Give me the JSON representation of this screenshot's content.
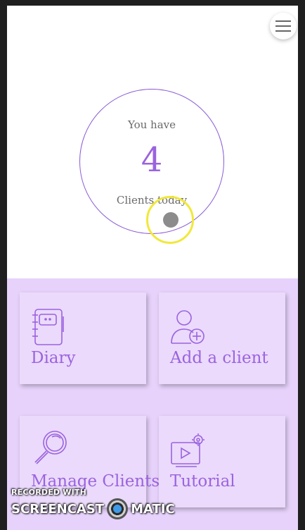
{
  "header": {
    "menu_icon": "hamburger-icon"
  },
  "summary": {
    "line1": "You have",
    "count": "4",
    "line2": "Clients today"
  },
  "actions": [
    {
      "label": "Diary",
      "icon": "notebook-icon"
    },
    {
      "label": "Add a client",
      "icon": "add-user-icon"
    },
    {
      "label": "Manage Clients",
      "icon": "magnifier-icon"
    },
    {
      "label": "Tutorial",
      "icon": "video-settings-icon"
    }
  ],
  "watermark": {
    "line1": "RECORDED WITH",
    "left": "SCREENCAST",
    "right": "MATIC"
  },
  "colors": {
    "accent": "#9b63df",
    "panel": "#e7d2fb",
    "card": "#ebdafb",
    "cursor_ring": "#f1e83a"
  }
}
